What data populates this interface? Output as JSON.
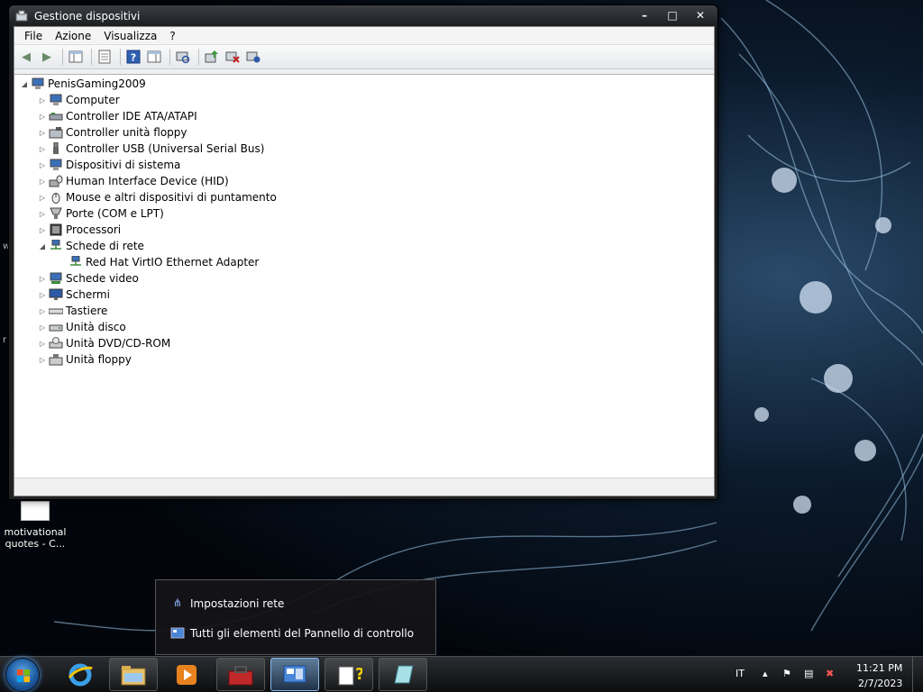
{
  "window": {
    "title": "Gestione dispositivi",
    "menu": [
      "File",
      "Azione",
      "Visualizza",
      "?"
    ],
    "toolbar_icons": [
      "back-icon",
      "forward-icon",
      "show-hide-console-tree-icon",
      "properties-icon",
      "help-icon",
      "action-pane-icon",
      "scan-hardware-icon",
      "update-driver-icon",
      "disable-device-icon",
      "uninstall-device-icon"
    ]
  },
  "tree": {
    "root": "PenisGaming2009",
    "categories": [
      {
        "label": "Computer",
        "expanded": false
      },
      {
        "label": "Controller IDE ATA/ATAPI",
        "expanded": false
      },
      {
        "label": "Controller unità floppy",
        "expanded": false
      },
      {
        "label": "Controller USB (Universal Serial Bus)",
        "expanded": false
      },
      {
        "label": "Dispositivi di sistema",
        "expanded": false
      },
      {
        "label": "Human Interface Device (HID)",
        "expanded": false
      },
      {
        "label": "Mouse e altri dispositivi di puntamento",
        "expanded": false
      },
      {
        "label": "Porte (COM e LPT)",
        "expanded": false
      },
      {
        "label": "Processori",
        "expanded": false
      },
      {
        "label": "Schede di rete",
        "expanded": true
      },
      {
        "label": "Red Hat VirtIO Ethernet Adapter",
        "child": true
      },
      {
        "label": "Schede video",
        "expanded": false
      },
      {
        "label": "Schermi",
        "expanded": false
      },
      {
        "label": "Tastiere",
        "expanded": false
      },
      {
        "label": "Unità disco",
        "expanded": false
      },
      {
        "label": "Unità DVD/CD-ROM",
        "expanded": false
      },
      {
        "label": "Unità floppy",
        "expanded": false
      }
    ]
  },
  "desktop": {
    "icon_label_line1": "motivational",
    "icon_label_line2": "quotes - C...",
    "edge_text_1": "w",
    "edge_text_2": "r"
  },
  "jumplist": {
    "items": [
      "Impostazioni rete",
      "Tutti gli elementi del Pannello di controllo"
    ]
  },
  "taskbar": {
    "language": "IT",
    "time": "11:21 PM",
    "date": "2/7/2023"
  }
}
